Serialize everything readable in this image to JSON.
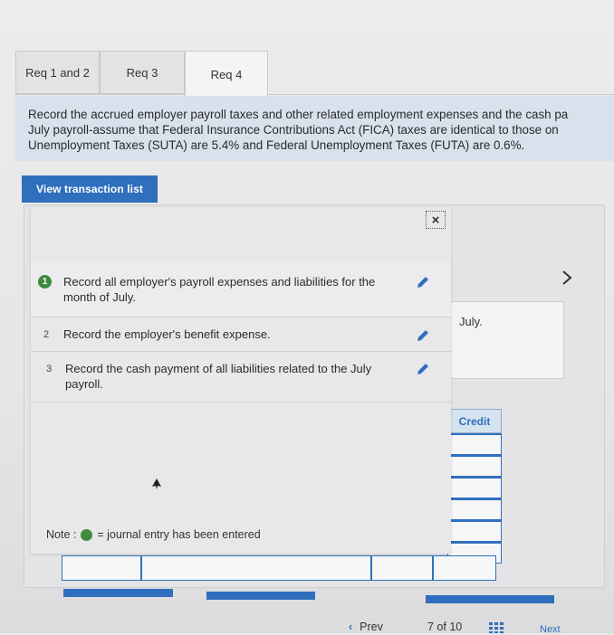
{
  "tabs": [
    {
      "label": "Req 1 and 2"
    },
    {
      "label": "Req 3"
    },
    {
      "label": "Req 4"
    }
  ],
  "instructions": {
    "line1": "Record the accrued employer payroll taxes and other related employment expenses and the cash pa",
    "line2": "July payroll-assume that Federal Insurance Contributions Act (FICA) taxes are identical to those on",
    "line3": "Unemployment Taxes (SUTA) are 5.4% and Federal Unemployment Taxes (FUTA) are 0.6%."
  },
  "view_button": {
    "label": "View transaction list"
  },
  "transactions": [
    {
      "number": "1",
      "text": "Record all employer's payroll expenses and liabilities for the month of July."
    },
    {
      "number": "2",
      "text": "Record the employer's benefit expense."
    },
    {
      "number": "3",
      "text": "Record the cash payment of all liabilities related to the July payroll."
    }
  ],
  "note": {
    "label": "Note :",
    "text": "= journal entry has been entered"
  },
  "journal": {
    "date_label": "July.",
    "credit_header": "Credit"
  },
  "pager": {
    "prev_label": "Prev",
    "page_text": "7 of 10",
    "next_label": "Next"
  },
  "icons": {
    "close": "×",
    "chevron": "›"
  },
  "colors": {
    "accent": "#2f6fbd",
    "done_green": "#3f8b3f",
    "instruction_bg": "#d8e2ec"
  }
}
